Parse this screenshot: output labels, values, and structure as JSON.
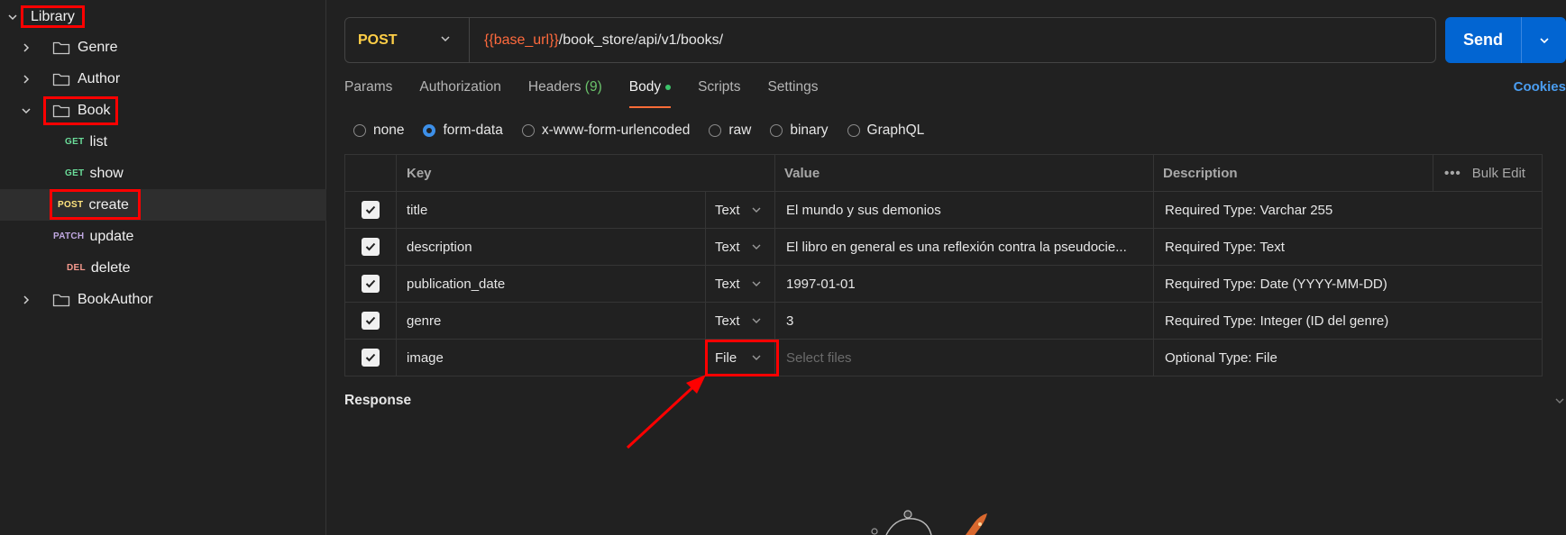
{
  "sidebar": {
    "root": "Library",
    "items": [
      {
        "type": "folder",
        "label": "Genre",
        "expanded": false
      },
      {
        "type": "folder",
        "label": "Author",
        "expanded": false
      },
      {
        "type": "folder",
        "label": "Book",
        "expanded": true
      },
      {
        "type": "request",
        "method": "GET",
        "label": "list"
      },
      {
        "type": "request",
        "method": "GET",
        "label": "show"
      },
      {
        "type": "request",
        "method": "POST",
        "label": "create",
        "selected": true
      },
      {
        "type": "request",
        "method": "PATCH",
        "label": "update"
      },
      {
        "type": "request",
        "method": "DEL",
        "label": "delete"
      },
      {
        "type": "folder",
        "label": "BookAuthor",
        "expanded": false
      }
    ]
  },
  "request": {
    "method": "POST",
    "url_var": "{{base_url}}",
    "url_path": "/book_store/api/v1/books/",
    "send_label": "Send"
  },
  "tabs": {
    "params": "Params",
    "authorization": "Authorization",
    "headers": "Headers",
    "headers_count": "(9)",
    "body": "Body",
    "scripts": "Scripts",
    "settings": "Settings",
    "cookies": "Cookies"
  },
  "body_types": [
    "none",
    "form-data",
    "x-www-form-urlencoded",
    "raw",
    "binary",
    "GraphQL"
  ],
  "body_type_selected": "form-data",
  "table": {
    "headers": {
      "key": "Key",
      "value": "Value",
      "description": "Description",
      "bulk_edit": "Bulk Edit"
    },
    "rows": [
      {
        "key": "title",
        "type": "Text",
        "value": "El mundo y sus demonios",
        "description": "Required Type: Varchar 255"
      },
      {
        "key": "description",
        "type": "Text",
        "value": "El libro en general es una reflexión contra la pseudocie...",
        "description": "Required Type: Text"
      },
      {
        "key": "publication_date",
        "type": "Text",
        "value": "1997-01-01",
        "description": "Required Type: Date (YYYY-MM-DD)"
      },
      {
        "key": "genre",
        "type": "Text",
        "value": "3",
        "description": "Required Type: Integer (ID del genre)"
      },
      {
        "key": "image",
        "type": "File",
        "value": "",
        "placeholder": "Select files",
        "description": "Optional Type: File"
      }
    ]
  },
  "response": {
    "label": "Response"
  },
  "colors": {
    "accent": "#ff6c37",
    "send": "#0265d2",
    "post": "#ffcf47",
    "highlight": "#ff0000"
  }
}
